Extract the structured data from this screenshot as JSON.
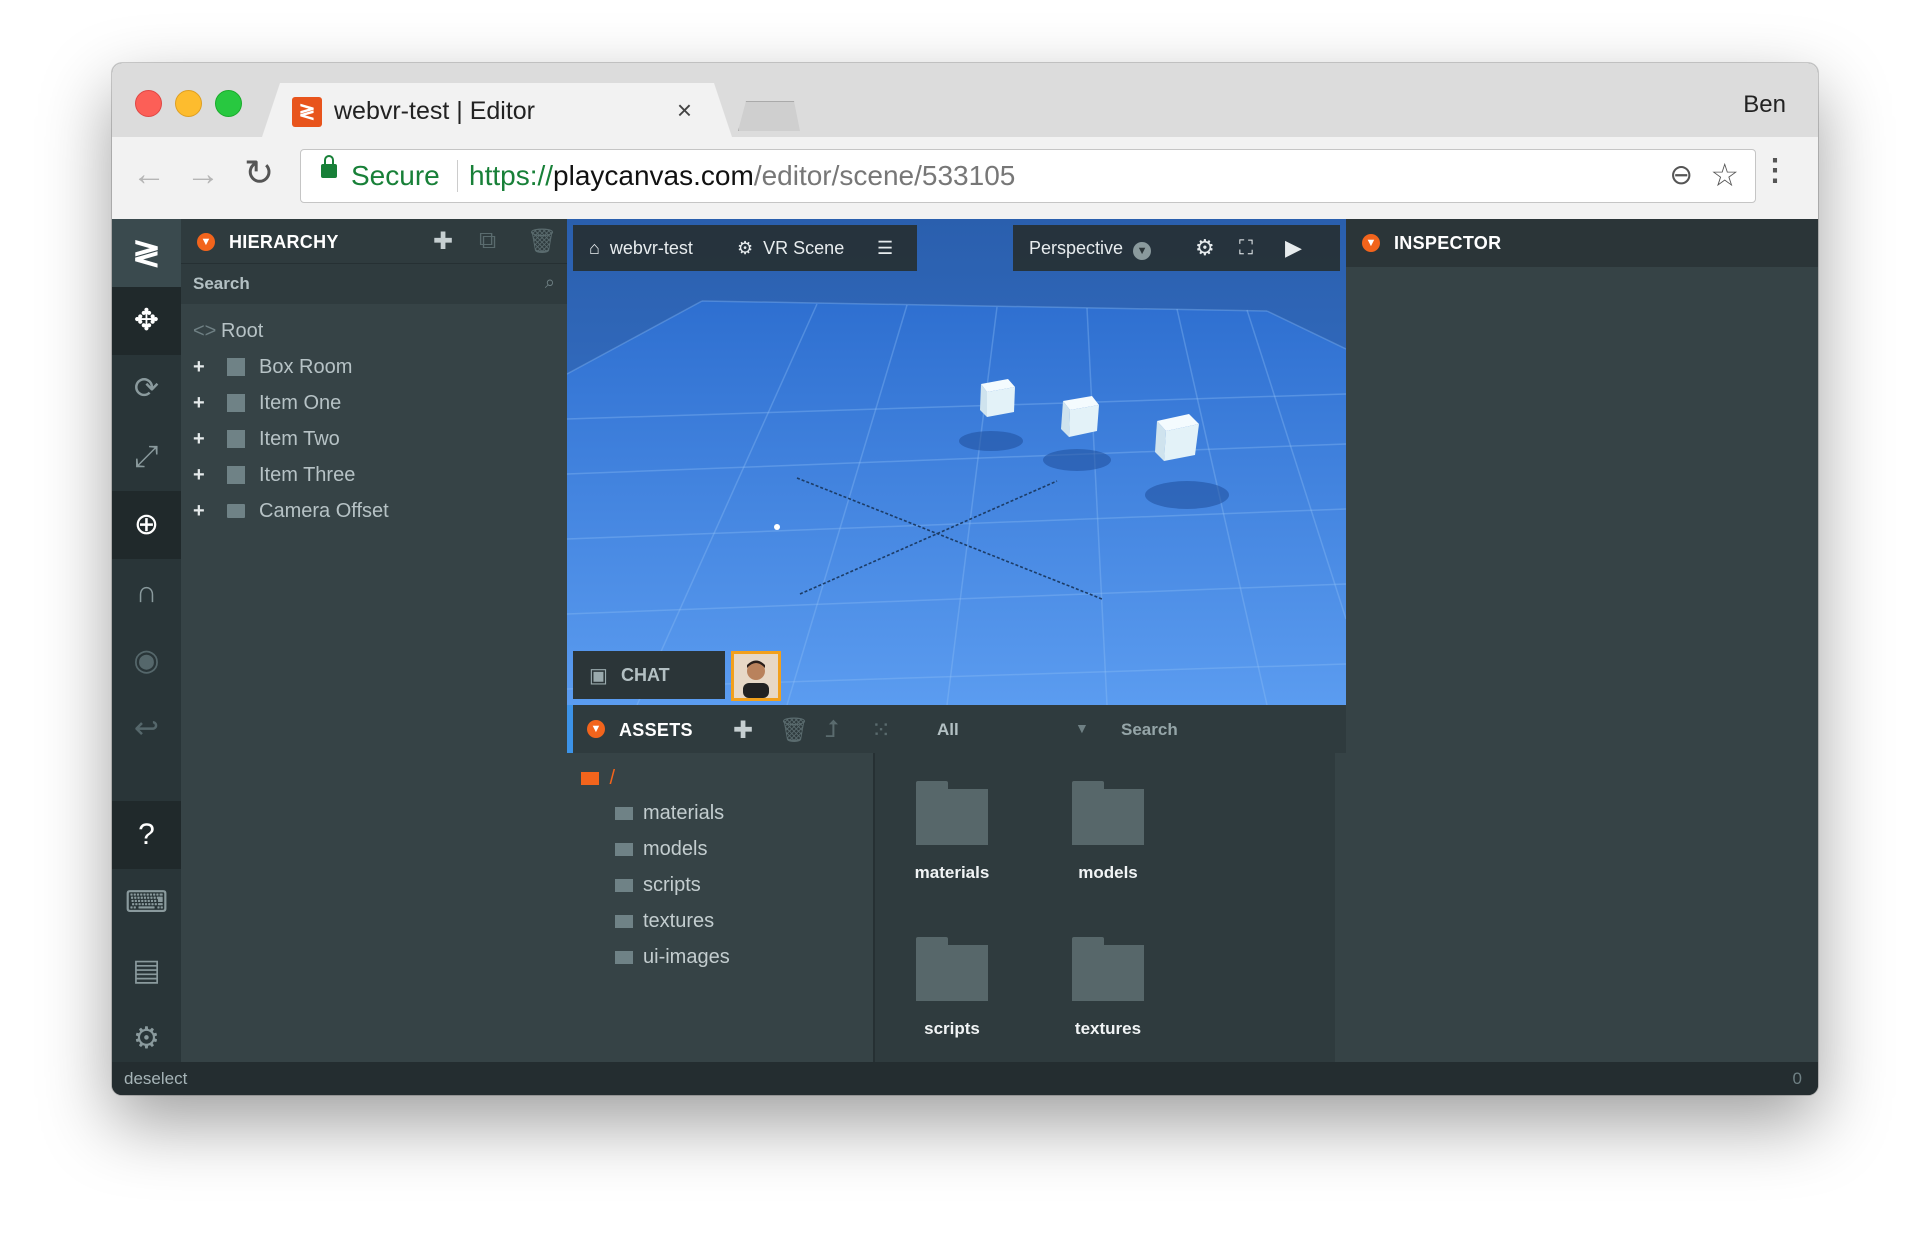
{
  "browser": {
    "tab_title": "webvr-test | Editor",
    "tab_close": "×",
    "profile_name": "Ben",
    "secure_label": "Secure",
    "url_scheme": "https://",
    "url_host": "playcanvas.com",
    "url_path": "/editor/scene/533105"
  },
  "hierarchy": {
    "title": "HIERARCHY",
    "search_placeholder": "Search",
    "root_label": "Root",
    "items": [
      {
        "label": "Box Room",
        "icon": "entity-icon"
      },
      {
        "label": "Item One",
        "icon": "entity-icon"
      },
      {
        "label": "Item Two",
        "icon": "entity-icon"
      },
      {
        "label": "Item Three",
        "icon": "entity-icon"
      },
      {
        "label": "Camera Offset",
        "icon": "folder-icon"
      }
    ]
  },
  "viewport": {
    "project_label": "webvr-test",
    "scene_label": "VR Scene",
    "camera_label": "Perspective",
    "chat_label": "CHAT"
  },
  "assets": {
    "title": "ASSETS",
    "filter_label": "All",
    "search_placeholder": "Search",
    "root_path": "/",
    "folders": [
      "materials",
      "models",
      "scripts",
      "textures",
      "ui-images"
    ],
    "grid_items": [
      "materials",
      "models",
      "scripts",
      "textures"
    ]
  },
  "inspector": {
    "title": "INSPECTOR"
  },
  "status": {
    "text": "deselect",
    "count": "0"
  },
  "colors": {
    "accent": "#f2641c",
    "viewport_blue": "#3a82dc",
    "panel": "#364346"
  }
}
